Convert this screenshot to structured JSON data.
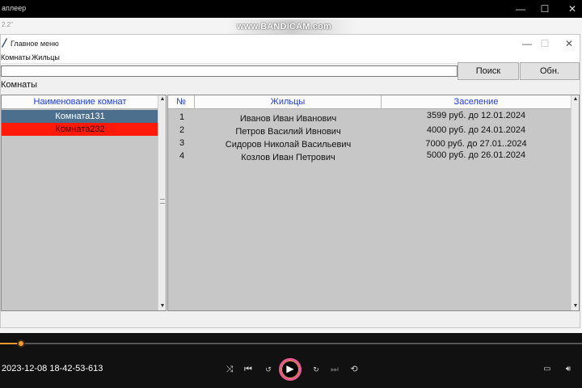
{
  "player": {
    "title": "аплеер",
    "timestamp": "2023-12-08 18-42-53-613",
    "watermark": "www.BANDICAM.com",
    "ghost": "2.2\"",
    "progress": 0.035,
    "colors": {
      "accent": "#f39a2e",
      "play_ring": "#e55b8d"
    },
    "controls": [
      "shuffle-icon",
      "previous-icon",
      "rewind-10-icon",
      "play-icon",
      "forward-30-icon",
      "next-icon",
      "repeat-icon",
      "subtitle-icon",
      "volume-icon"
    ]
  },
  "window": {
    "title": "Главное меню",
    "menu": [
      "Комнаты",
      "Жильцы"
    ],
    "search_value": "",
    "search_button": "Поиск",
    "refresh_button": "Обн.",
    "section_label": "Комнаты"
  },
  "rooms": {
    "header": "Наименование комнат",
    "items": [
      {
        "name": "Комната131",
        "state": "selected",
        "color": "#4d6f8e"
      },
      {
        "name": "Комната232",
        "state": "alarm",
        "color": "#ff1a0a"
      }
    ]
  },
  "residents": {
    "headers": [
      "№",
      "Жильцы",
      "Заселение"
    ],
    "rows": [
      {
        "n": "1",
        "name": "Иванов Иван Иванович",
        "stay": "3599 руб. до 12.01.2024"
      },
      {
        "n": "2",
        "name": "Петров Василий Ивнович",
        "stay": "4000 руб. до 24.01.2024"
      },
      {
        "n": "3",
        "name": "Сидоров Николай Васильевич",
        "stay": "7000 руб. до 27.01..2024"
      },
      {
        "n": "4",
        "name": "Козлов Иван Петрович",
        "stay": "5000 руб. до 26.01.2024"
      }
    ]
  }
}
